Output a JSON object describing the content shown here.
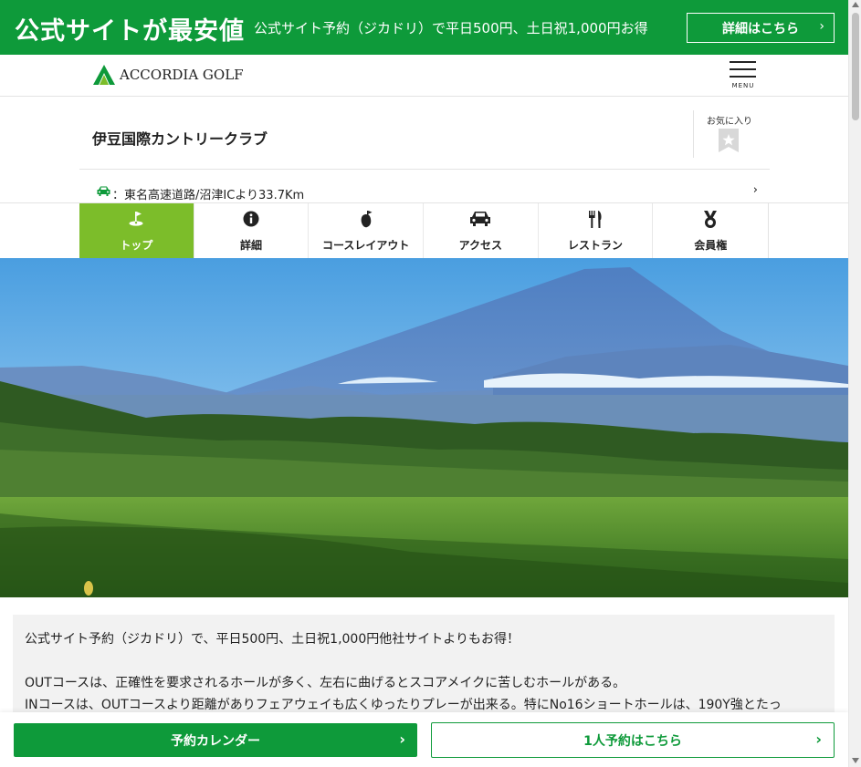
{
  "promo": {
    "headline": "公式サイトが最安値",
    "subtext": "公式サイト予約（ジカドリ）で平日500円、土日祝1,000円お得",
    "detail_button": "詳細はこちら",
    "chevron": "›"
  },
  "header": {
    "logo_text": "ACCORDIA GOLF",
    "menu_label": "MENU"
  },
  "club": {
    "name": "伊豆国際カントリークラブ",
    "favorite_label": "お気に入り",
    "access_text": "：東名高速道路/沼津ICより33.7Km",
    "access_chevron": "›"
  },
  "tabs": [
    {
      "label": "トップ",
      "icon": "golf-flag-icon",
      "active": true
    },
    {
      "label": "詳細",
      "icon": "info-icon",
      "active": false
    },
    {
      "label": "コースレイアウト",
      "icon": "course-layout-icon",
      "active": false
    },
    {
      "label": "アクセス",
      "icon": "car-icon",
      "active": false
    },
    {
      "label": "レストラン",
      "icon": "fork-knife-icon",
      "active": false
    },
    {
      "label": "会員権",
      "icon": "medal-icon",
      "active": false
    }
  ],
  "description": {
    "line1": "公式サイト予約（ジカドリ）で、平日500円、土日祝1,000円他社サイトよりもお得！",
    "line2": "OUTコースは、正確性を要求されるホールが多く、左右に曲げるとスコアメイクに苦しむホールがある。",
    "line3": "INコースは、OUTコースより距離がありフェアウェイも広くゆったりプレーが出来る。特にNo16ショートホールは、190Y強とたっ"
  },
  "bottom": {
    "calendar_button": "予約カレンダー",
    "solo_button": "1人予約はこちら",
    "chevron": "›"
  },
  "colors": {
    "brand_green": "#0e9a3a",
    "active_tab": "#7cbd2a"
  }
}
